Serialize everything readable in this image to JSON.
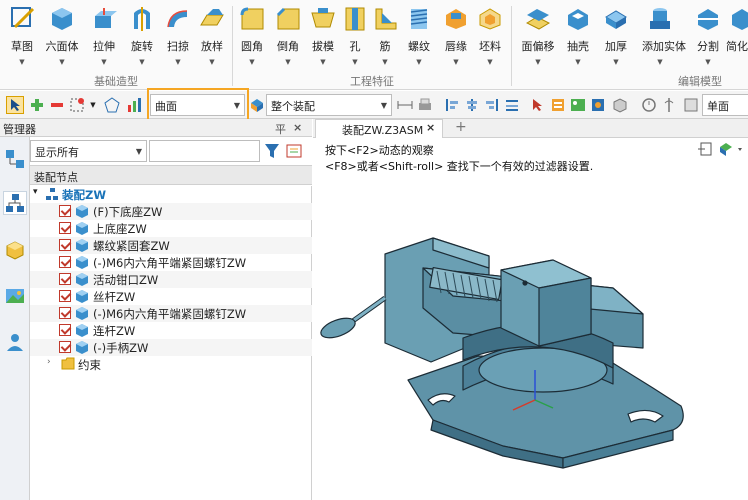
{
  "ribbon": {
    "tools": [
      {
        "label": "草图",
        "icon": "sketch-icon"
      },
      {
        "label": "六面体",
        "icon": "hexahedron-icon"
      },
      {
        "label": "拉伸",
        "icon": "extrude-icon"
      },
      {
        "label": "旋转",
        "icon": "revolve-icon"
      },
      {
        "label": "扫掠",
        "icon": "sweep-icon"
      },
      {
        "label": "放样",
        "icon": "loft-icon"
      },
      {
        "label": "圆角",
        "icon": "fillet-icon"
      },
      {
        "label": "倒角",
        "icon": "chamfer-icon"
      },
      {
        "label": "拔模",
        "icon": "draft-icon"
      },
      {
        "label": "孔",
        "icon": "hole-icon"
      },
      {
        "label": "筋",
        "icon": "rib-icon"
      },
      {
        "label": "螺纹",
        "icon": "thread-icon"
      },
      {
        "label": "唇缘",
        "icon": "lip-icon"
      },
      {
        "label": "坯料",
        "icon": "stock-icon"
      },
      {
        "label": "面偏移",
        "icon": "face-offset-icon"
      },
      {
        "label": "抽壳",
        "icon": "shell-icon"
      },
      {
        "label": "加厚",
        "icon": "thicken-icon"
      },
      {
        "label": "添加实体",
        "icon": "add-solid-icon"
      },
      {
        "label": "分割",
        "icon": "split-icon"
      },
      {
        "label": "简化",
        "icon": "simplify-icon"
      }
    ],
    "groups": [
      {
        "label": "基础造型"
      },
      {
        "label": "工程特征"
      },
      {
        "label": "编辑模型"
      }
    ]
  },
  "toolbar": {
    "filter_value": "曲面",
    "scope_value": "整个装配",
    "view_value": "单面"
  },
  "manager": {
    "title": "管理器",
    "show_filter": "显示所有",
    "node_header": "装配节点",
    "root": "装配ZW",
    "items": [
      "(F)下底座ZW",
      "上底座ZW",
      "螺纹紧固套ZW",
      "(-)M6内六角平端紧固螺钉ZW",
      "活动钳口ZW",
      "丝杆ZW",
      "(-)M6内六角平端紧固螺钉ZW",
      "连杆ZW",
      "(-)手柄ZW"
    ],
    "constraints": "约束",
    "pin_label": "平",
    "close_label": "×"
  },
  "document": {
    "tab_title": "装配ZW.Z3ASM",
    "close_label": "×",
    "add_label": "+",
    "hint_line1": "按下<F2>动态的观察",
    "hint_line2": "<F8>或者<Shift-roll> 查找下一个有效的过滤器设置."
  },
  "colors": {
    "accent": "#f5a623",
    "model": "#5f93a8",
    "tree_blue": "#1a73b8"
  }
}
